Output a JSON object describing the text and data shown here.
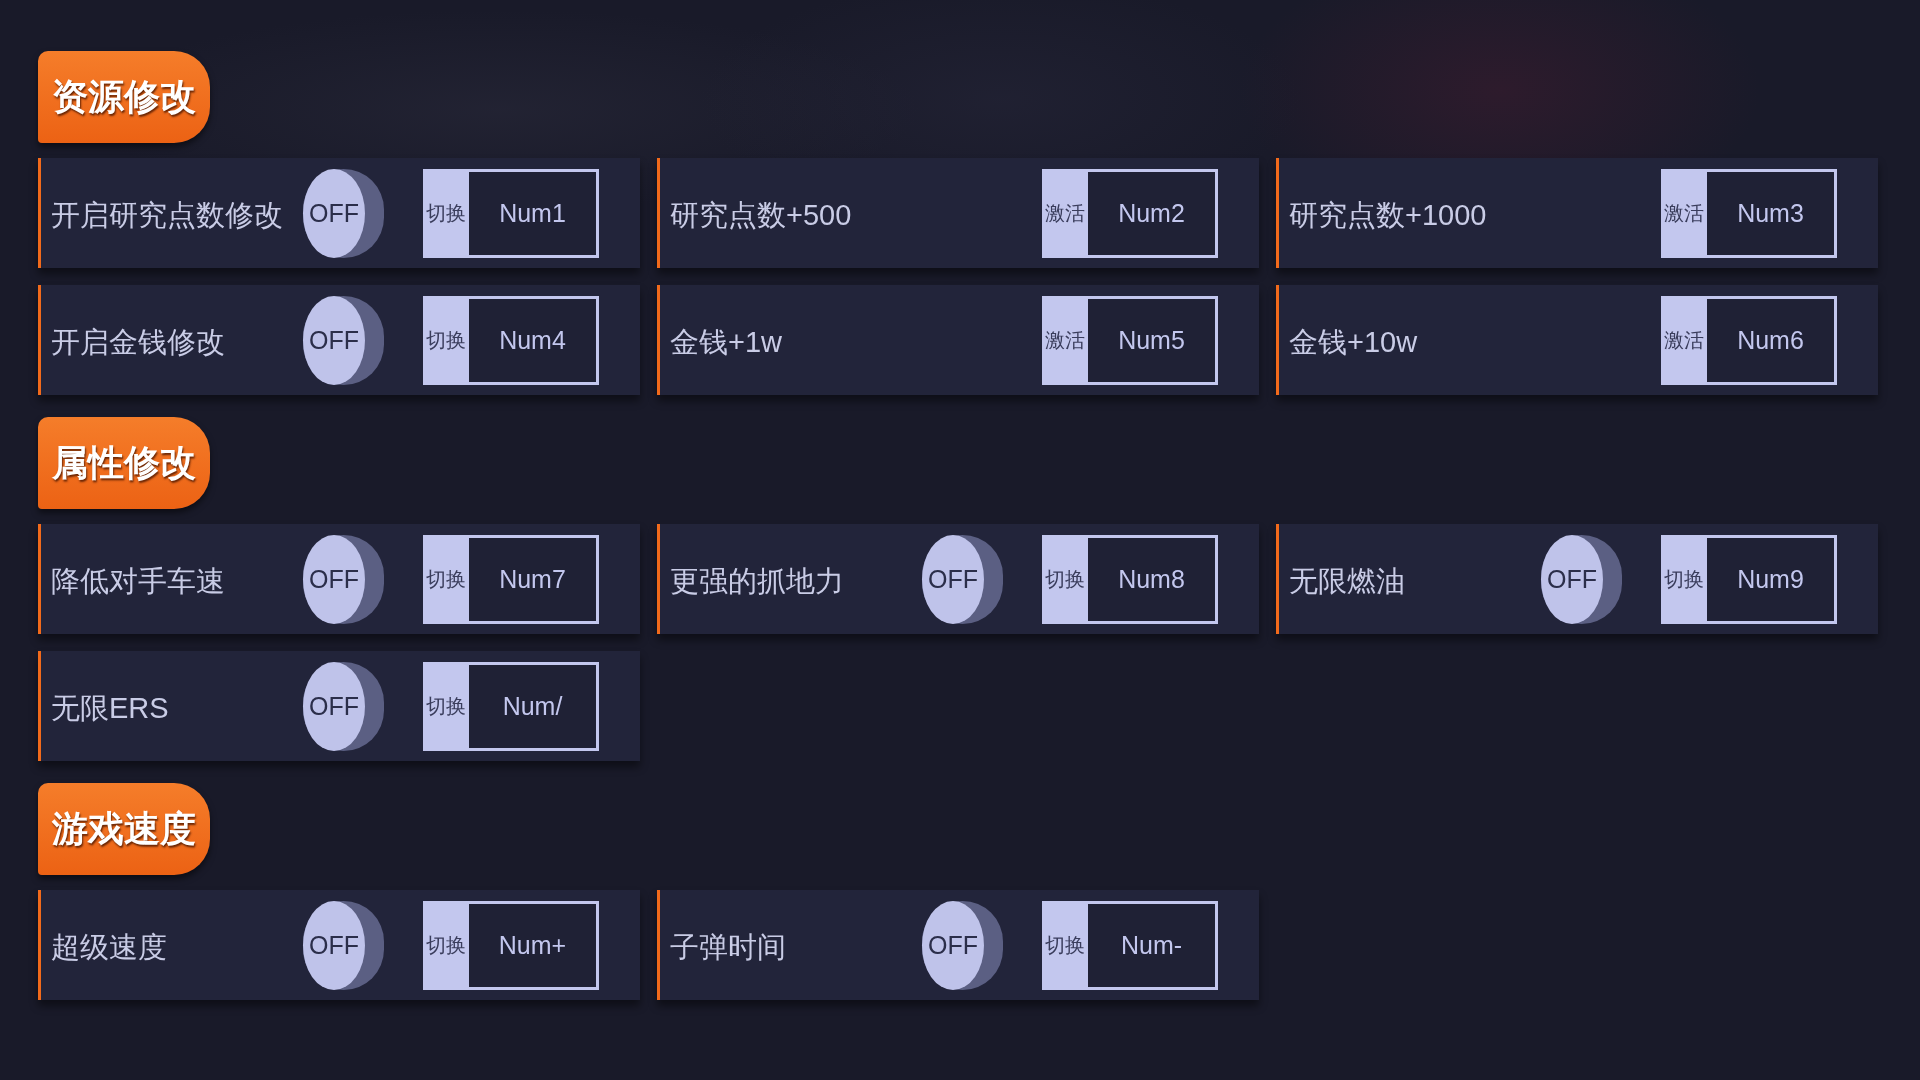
{
  "sections": [
    {
      "title": "资源修改",
      "items": [
        {
          "kind": "toggle",
          "label": "开启研究点数修改",
          "on": false,
          "switch_text": "OFF",
          "action": "切换",
          "hotkey": "Num1"
        },
        {
          "kind": "trigger",
          "label": "研究点数+500",
          "action": "激活",
          "hotkey": "Num2"
        },
        {
          "kind": "trigger",
          "label": "研究点数+1000",
          "action": "激活",
          "hotkey": "Num3"
        },
        {
          "kind": "toggle",
          "label": "开启金钱修改",
          "on": false,
          "switch_text": "OFF",
          "action": "切换",
          "hotkey": "Num4"
        },
        {
          "kind": "trigger",
          "label": "金钱+1w",
          "action": "激活",
          "hotkey": "Num5"
        },
        {
          "kind": "trigger",
          "label": "金钱+10w",
          "action": "激活",
          "hotkey": "Num6"
        }
      ]
    },
    {
      "title": "属性修改",
      "items": [
        {
          "kind": "toggle",
          "label": "降低对手车速",
          "on": false,
          "switch_text": "OFF",
          "action": "切换",
          "hotkey": "Num7"
        },
        {
          "kind": "toggle",
          "label": "更强的抓地力",
          "on": false,
          "switch_text": "OFF",
          "action": "切换",
          "hotkey": "Num8"
        },
        {
          "kind": "toggle",
          "label": "无限燃油",
          "on": false,
          "switch_text": "OFF",
          "action": "切换",
          "hotkey": "Num9"
        },
        {
          "kind": "toggle",
          "label": "无限ERS",
          "on": false,
          "switch_text": "OFF",
          "action": "切换",
          "hotkey": "Num/"
        }
      ]
    },
    {
      "title": "游戏速度",
      "items": [
        {
          "kind": "toggle",
          "label": "超级速度",
          "on": false,
          "switch_text": "OFF",
          "action": "切换",
          "hotkey": "Num+"
        },
        {
          "kind": "toggle",
          "label": "子弹时间",
          "on": false,
          "switch_text": "OFF",
          "action": "切换",
          "hotkey": "Num-"
        }
      ]
    }
  ]
}
